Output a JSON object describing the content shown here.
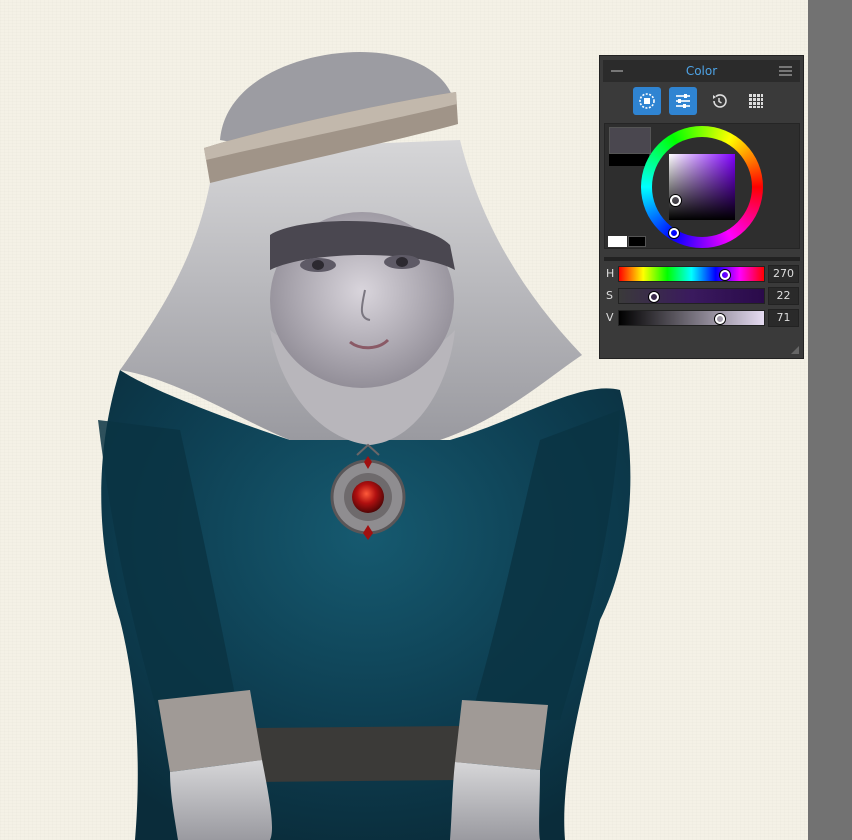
{
  "panel": {
    "title": "Color",
    "tabs": [
      {
        "name": "wheel-mode-icon",
        "active": true
      },
      {
        "name": "sliders-icon",
        "active": true
      },
      {
        "name": "history-icon",
        "active": false
      },
      {
        "name": "palette-grid-icon",
        "active": false
      }
    ],
    "foreground_color": "#4a474f",
    "background_color": "#000000",
    "sliders": [
      {
        "label": "H",
        "value": "270",
        "fraction": 0.75
      },
      {
        "label": "S",
        "value": "22",
        "fraction": 0.22
      },
      {
        "label": "V",
        "value": "71",
        "fraction": 0.71
      }
    ]
  },
  "colors": {
    "accent": "#2f84d2",
    "title_text": "#4ea3e6",
    "panel_bg": "#3a3a3a",
    "canvas_paper": "#f4f1e6"
  }
}
